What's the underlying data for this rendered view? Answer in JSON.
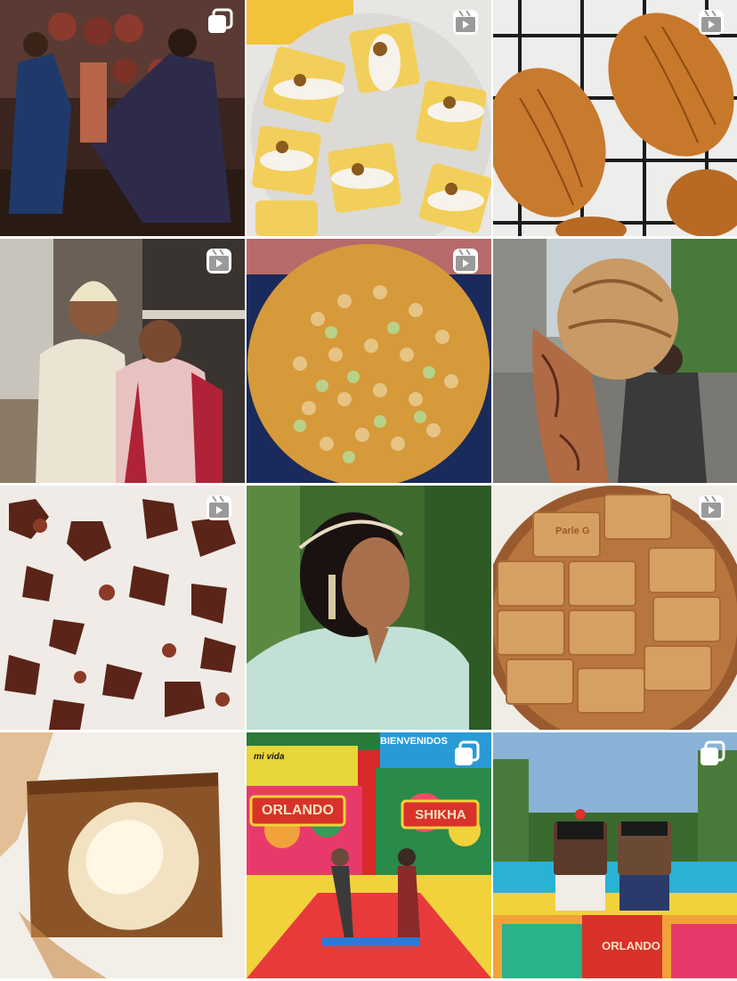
{
  "feed": {
    "posts": [
      {
        "subject": "dancing couple at celebration",
        "media_type": "carousel",
        "badge_icon": "carousel-icon"
      },
      {
        "subject": "mini cheesecake bars with whipped topping",
        "media_type": "reel",
        "badge_icon": "reel-icon"
      },
      {
        "subject": "puff pastry turnovers on cooling rack",
        "media_type": "reel",
        "badge_icon": "reel-icon"
      },
      {
        "subject": "wedding couple portrait",
        "media_type": "reel",
        "badge_icon": "reel-icon"
      },
      {
        "subject": "cookie topped with crushed seeds",
        "media_type": "reel",
        "badge_icon": "reel-icon"
      },
      {
        "subject": "hennaed hand holding bread roll",
        "media_type": "reel",
        "badge_icon": "reel-icon"
      },
      {
        "subject": "candied nuts on cream",
        "media_type": "reel",
        "badge_icon": "reel-icon"
      },
      {
        "subject": "smiling woman with head jewelry",
        "media_type": "image",
        "badge_icon": ""
      },
      {
        "subject": "tart lined with Parle-G biscuits",
        "media_type": "reel",
        "badge_icon": "reel-icon",
        "overlay_text": "Parle G"
      },
      {
        "subject": "gingerbread slice with cream quenelle",
        "media_type": "image",
        "badge_icon": ""
      },
      {
        "subject": "couple on colorful trajinera boat",
        "media_type": "carousel",
        "badge_icon": "carousel-icon",
        "overlay_text": [
          "BIENVENIDOS",
          "mi vida",
          "ORLANDO",
          "SHIKHA"
        ]
      },
      {
        "subject": "toy brick couple figurines on boat",
        "media_type": "carousel",
        "badge_icon": "carousel-icon",
        "overlay_text": "ORLANDO"
      }
    ]
  },
  "colors": {
    "badge": "#ffffff",
    "background": "#ffffff"
  }
}
